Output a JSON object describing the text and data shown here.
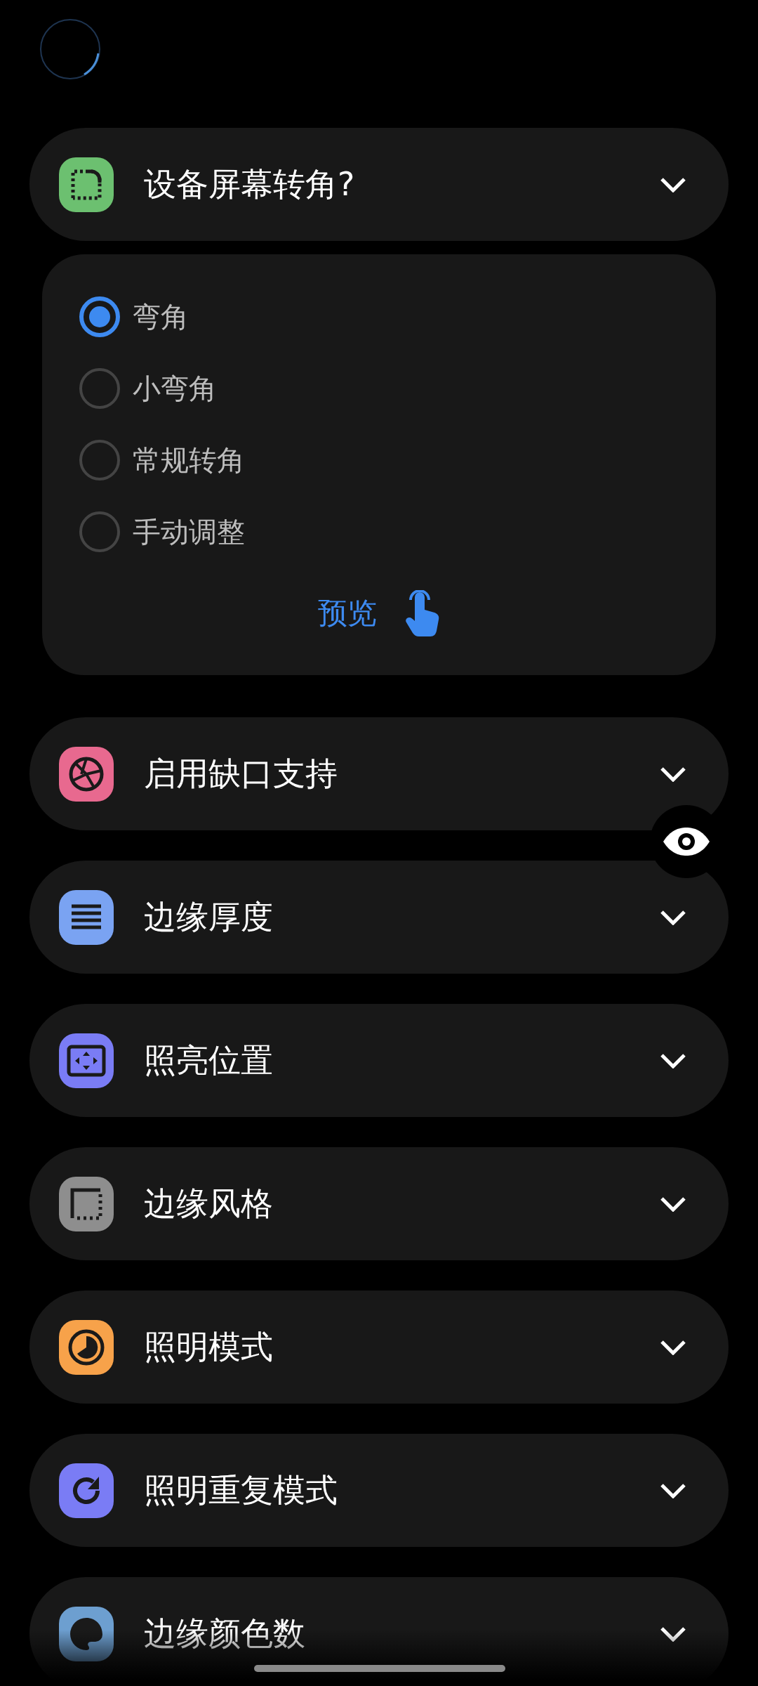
{
  "sections": [
    {
      "title": "设备屏幕转角?",
      "kind": "corner",
      "color": "#6cc070",
      "options": [
        {
          "label": "弯角",
          "selected": true
        },
        {
          "label": "小弯角",
          "selected": false
        },
        {
          "label": "常规转角",
          "selected": false
        },
        {
          "label": "手动调整",
          "selected": false
        }
      ],
      "preview": "预览"
    },
    {
      "title": "启用缺口支持",
      "kind": "aperture",
      "color": "#e8698f"
    },
    {
      "title": "边缘厚度",
      "kind": "lines",
      "color": "#7aa3f2"
    },
    {
      "title": "照亮位置",
      "kind": "frame",
      "color": "#7a7cf5"
    },
    {
      "title": "边缘风格",
      "kind": "dotted",
      "color": "#8e8e8e"
    },
    {
      "title": "照明模式",
      "kind": "clock",
      "color": "#f7a24a"
    },
    {
      "title": "照明重复模式",
      "kind": "repeat",
      "color": "#7a7cf5"
    },
    {
      "title": "边缘颜色数",
      "kind": "palette",
      "color": "#6d9fd0"
    }
  ]
}
